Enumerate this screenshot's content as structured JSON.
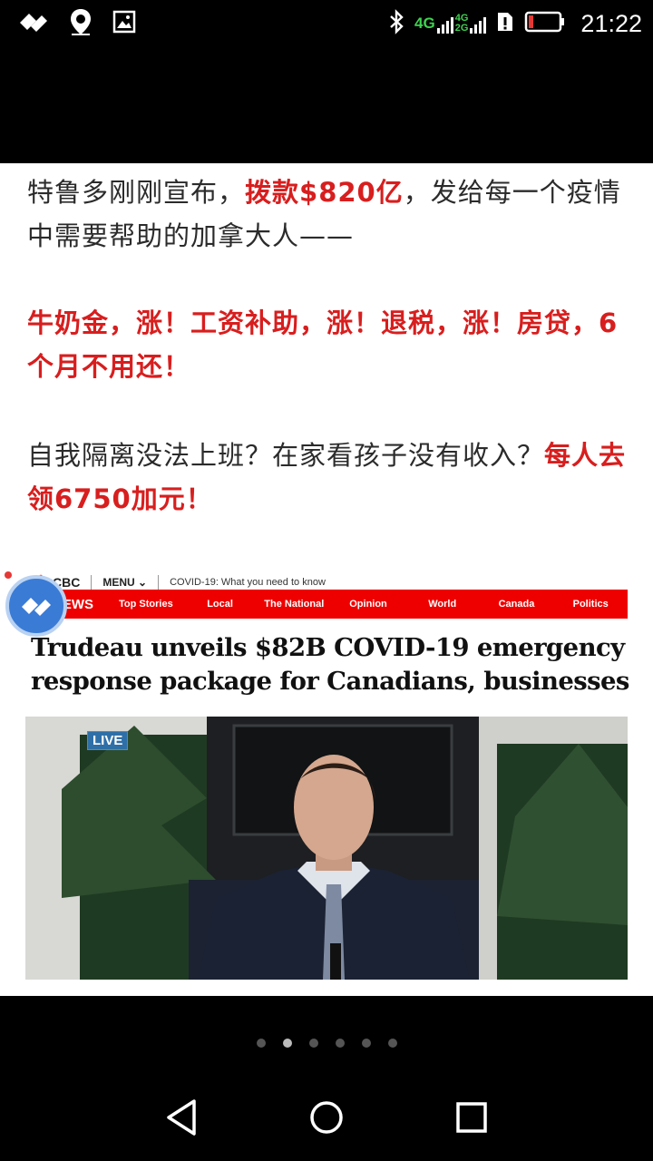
{
  "status_bar": {
    "time": "21:22",
    "network_primary": "4G",
    "network_secondary_top": "4G",
    "network_secondary_bottom": "2G",
    "icons_left": [
      "app-icon",
      "location-icon",
      "image-icon"
    ],
    "icons_right": [
      "bluetooth-icon",
      "signal-icon",
      "sim-alert-icon",
      "battery-icon"
    ]
  },
  "article": {
    "p1_a": "特鲁多刚刚宣布，",
    "p1_hl": "拨款$820亿",
    "p1_b": "，发给每一个疫情中需要帮助的加拿大人——",
    "p2_hl": "牛奶金，涨！工资补助，涨！退税，涨！房贷，6个月不用还！",
    "p3_a": "自我隔离没法上班？在家看孩子没有收入？",
    "p3_hl": "每人去领6750加元！"
  },
  "cbc": {
    "logo_text": "CBC",
    "menu_label": "MENU",
    "covid_link": "COVID-19: What you need to know",
    "brand": "NEWS",
    "nav": [
      "Top Stories",
      "Local",
      "The National",
      "Opinion",
      "World",
      "Canada",
      "Politics"
    ],
    "headline": "Trudeau unveils $82B COVID-19 emergency response package for Canadians, businesses",
    "live_badge": "LIVE"
  },
  "pager": {
    "count": 6,
    "active_index": 1
  },
  "colors": {
    "highlight_red": "#d81e1e",
    "cbc_red": "#e00000",
    "network_green": "#3fd24f",
    "fab_blue": "#3a7bd5"
  }
}
